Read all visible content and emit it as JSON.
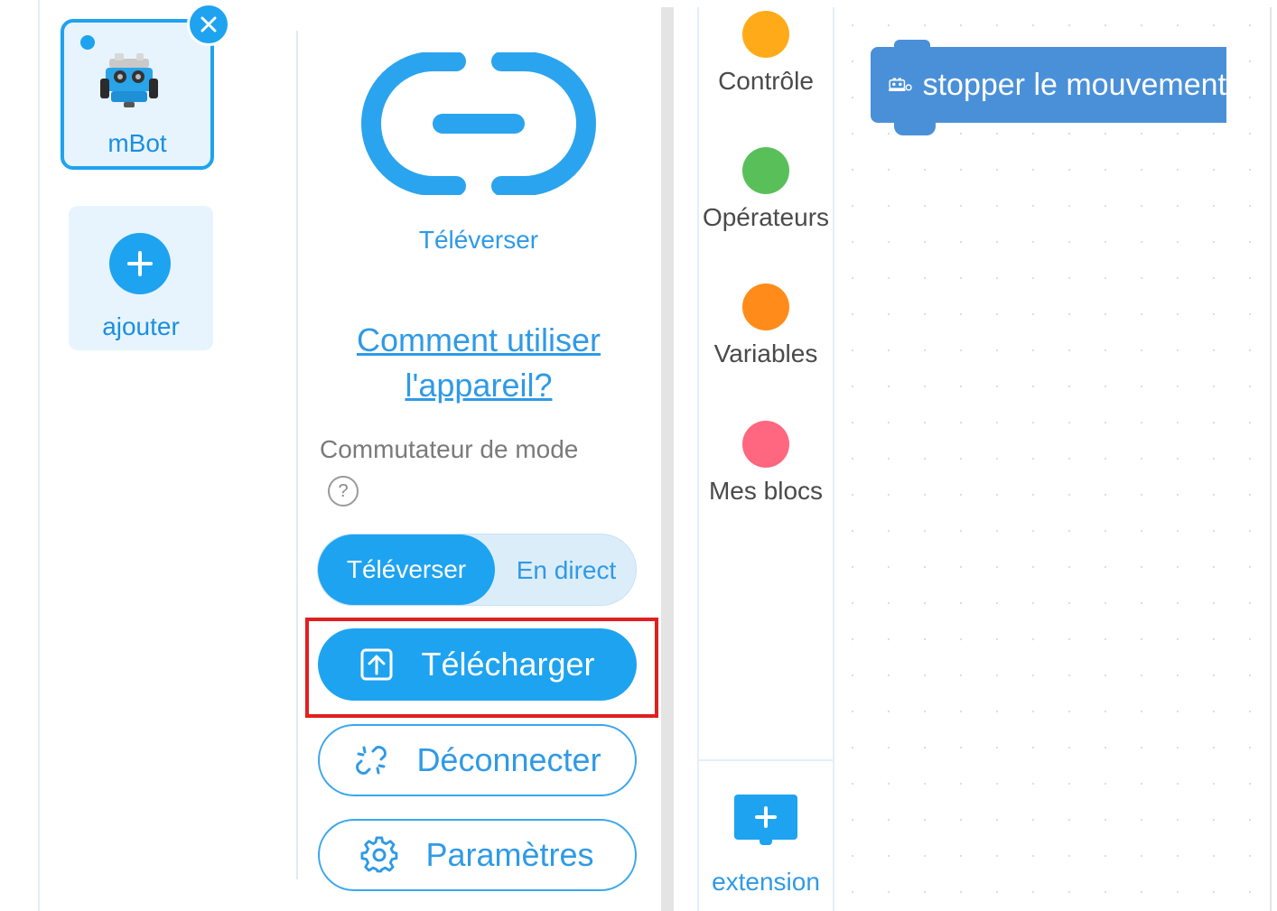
{
  "device": {
    "name": "mBot",
    "add_label": "ajouter"
  },
  "connection": {
    "upload_caption": "Téléverser",
    "help_link_line1": "Comment utiliser",
    "help_link_line2": "l'appareil?",
    "mode_switch_label": "Commutateur de mode",
    "help_symbol": "?",
    "mode_options": [
      "Téléverser",
      "En direct"
    ],
    "selected_mode": "Téléverser",
    "download_button": "Télécharger",
    "disconnect_button": "Déconnecter",
    "settings_button": "Paramètres"
  },
  "categories": [
    {
      "label": "Contrôle",
      "color": "#ffab19"
    },
    {
      "label": "Opérateurs",
      "color": "#59c059"
    },
    {
      "label": "Variables",
      "color": "#ff8c1a"
    },
    {
      "label": "Mes blocs",
      "color": "#ff6680"
    }
  ],
  "extension": {
    "label": "extension"
  },
  "workspace": {
    "block_text": "stopper le mouvement"
  },
  "colors": {
    "accent": "#1ea3f0",
    "highlight": "#e0201f",
    "block": "#4a90d9"
  }
}
